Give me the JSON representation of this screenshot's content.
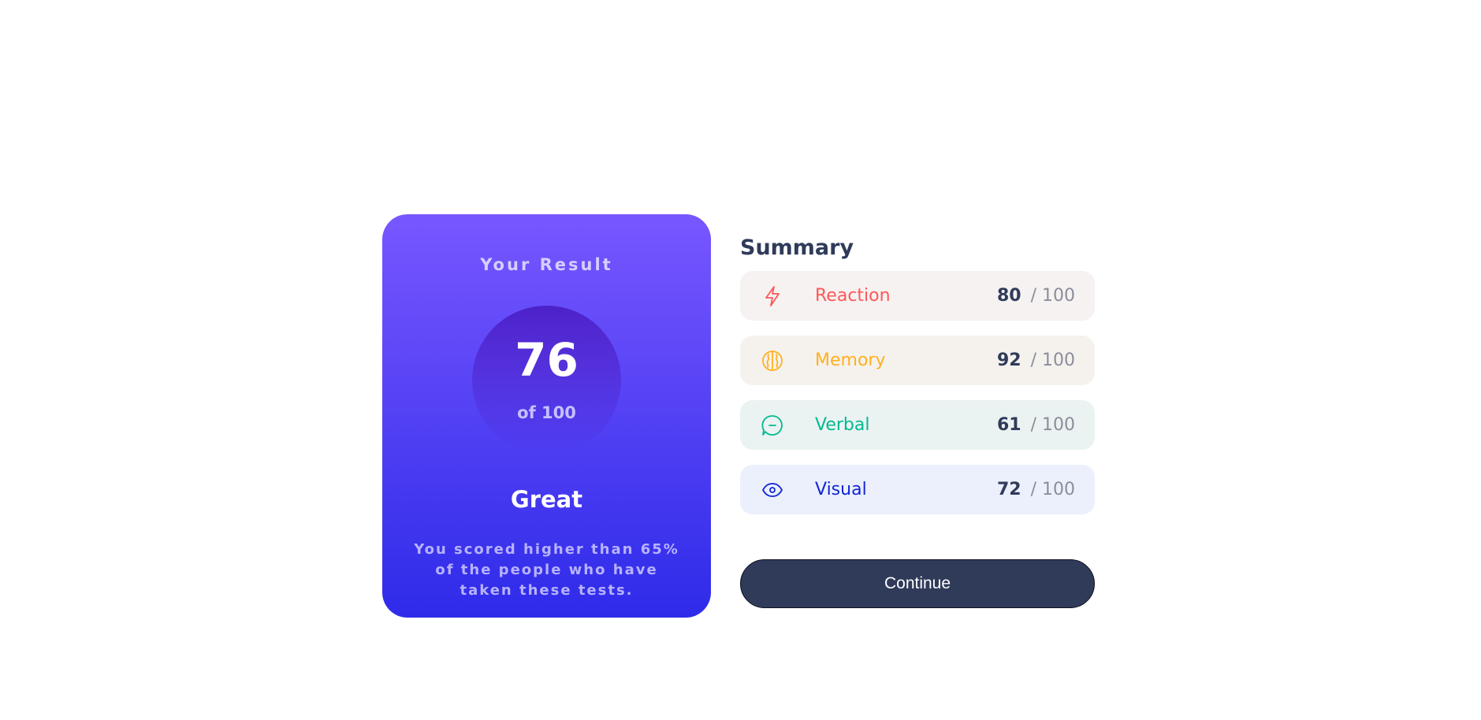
{
  "result": {
    "heading": "Your Result",
    "score": "76",
    "total": "of 100",
    "rating": "Great",
    "text": "You scored higher than 65% of the people who have taken these tests."
  },
  "summary": {
    "title": "Summary",
    "items": [
      {
        "label": "Reaction",
        "score": "80",
        "max": "/ 100",
        "icon": "lightning-icon",
        "color": "#ff5757",
        "bg": "#f5f2f1"
      },
      {
        "label": "Memory",
        "score": "92",
        "max": "/ 100",
        "icon": "brain-icon",
        "color": "#ffb01f",
        "bg": "#f5f2ee"
      },
      {
        "label": "Verbal",
        "score": "61",
        "max": "/ 100",
        "icon": "chat-bubble-icon",
        "color": "#00bb8f",
        "bg": "#ebf2f2"
      },
      {
        "label": "Visual",
        "score": "72",
        "max": "/ 100",
        "icon": "eye-icon",
        "color": "#1125d6",
        "bg": "#ebf0fc"
      }
    ]
  },
  "continue_label": "Continue"
}
